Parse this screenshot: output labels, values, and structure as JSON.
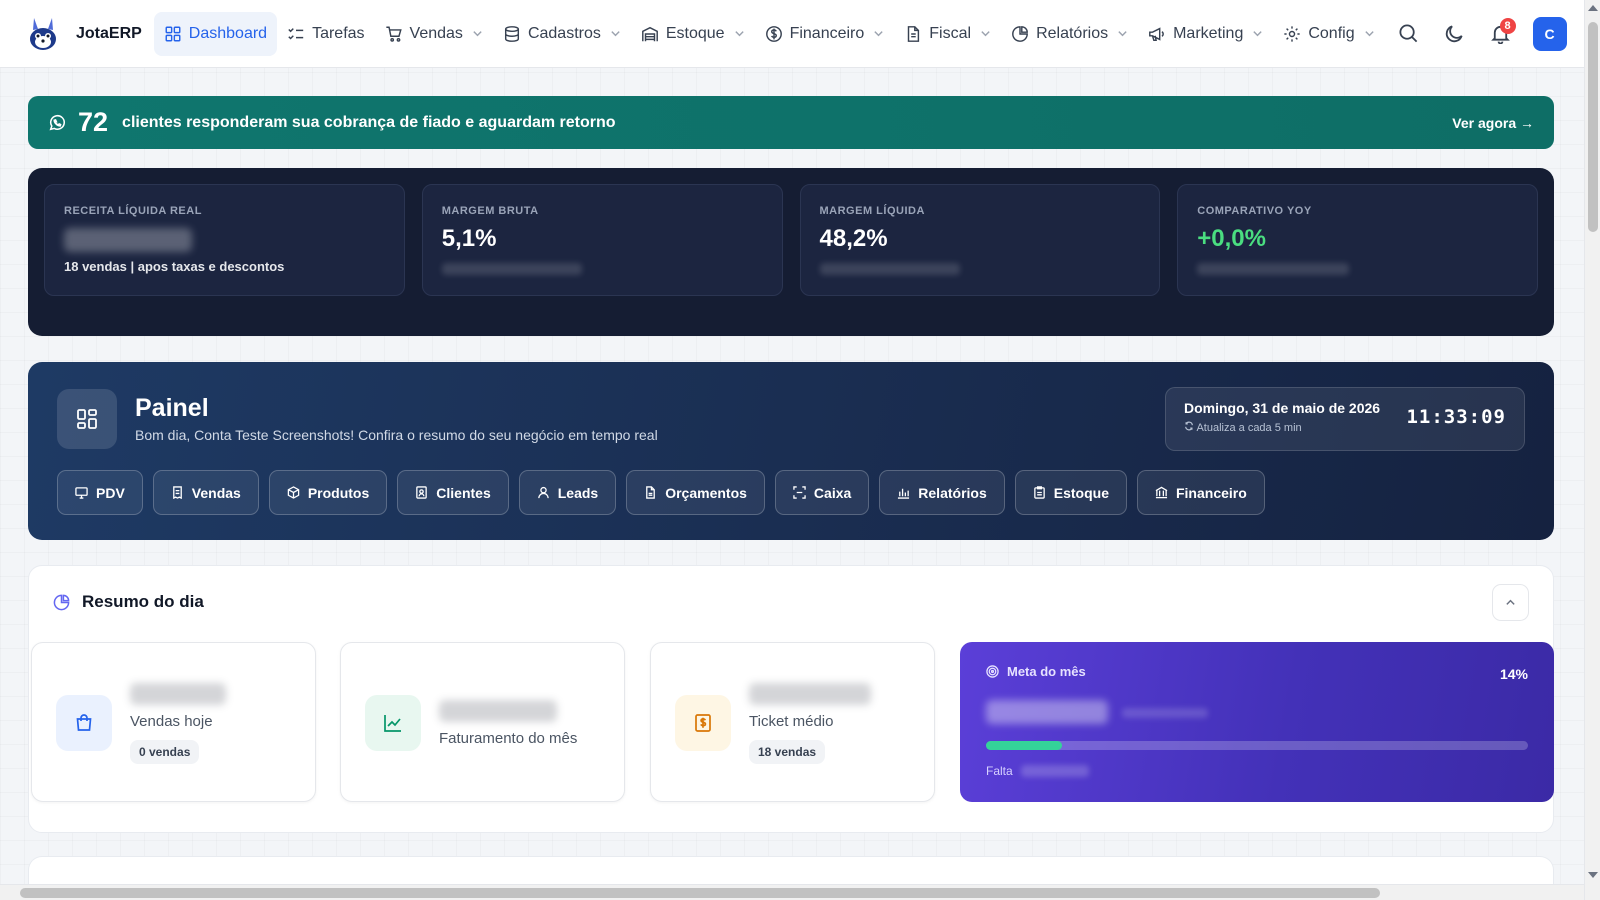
{
  "nav": {
    "brand": "JotaERP",
    "items": [
      {
        "label": "Dashboard",
        "icon": "grid-icon",
        "active": true,
        "dropdown": false
      },
      {
        "label": "Tarefas",
        "icon": "checklist-icon",
        "dropdown": false
      },
      {
        "label": "Vendas",
        "icon": "cart-icon",
        "dropdown": true
      },
      {
        "label": "Cadastros",
        "icon": "database-icon",
        "dropdown": true
      },
      {
        "label": "Estoque",
        "icon": "warehouse-icon",
        "dropdown": true
      },
      {
        "label": "Financeiro",
        "icon": "dollar-circle-icon",
        "dropdown": true
      },
      {
        "label": "Fiscal",
        "icon": "document-icon",
        "dropdown": true
      },
      {
        "label": "Relatórios",
        "icon": "pie-chart-icon",
        "dropdown": true
      },
      {
        "label": "Marketing",
        "icon": "megaphone-icon",
        "dropdown": true
      },
      {
        "label": "Config",
        "icon": "gear-icon",
        "dropdown": true
      }
    ],
    "notifications": "8",
    "avatar": "C"
  },
  "banner": {
    "count": "72",
    "message": "clientes responderam sua cobrança de fiado e aguardam retorno",
    "cta": "Ver agora →"
  },
  "kpis": [
    {
      "label": "RECEITA LÍQUIDA REAL",
      "value": null,
      "sub": "18 vendas | apos taxas e descontos"
    },
    {
      "label": "MARGEM BRUTA",
      "value": "5,1%",
      "sub": null
    },
    {
      "label": "MARGEM LÍQUIDA",
      "value": "48,2%",
      "sub": null
    },
    {
      "label": "COMPARATIVO YOY",
      "value": "+0,0%",
      "sub": null
    }
  ],
  "painel": {
    "title": "Painel",
    "subtitle": "Bom dia, Conta Teste Screenshots! Confira o resumo do seu negócio em tempo real",
    "date": "Domingo, 31 de maio de 2026",
    "refresh_hint": "Atualiza a cada 5 min",
    "clock": "11:33:09",
    "quick_links": [
      {
        "label": "PDV",
        "icon": "monitor-icon"
      },
      {
        "label": "Vendas",
        "icon": "receipt-icon"
      },
      {
        "label": "Produtos",
        "icon": "box-icon"
      },
      {
        "label": "Clientes",
        "icon": "contacts-icon"
      },
      {
        "label": "Leads",
        "icon": "user-icon"
      },
      {
        "label": "Orçamentos",
        "icon": "file-icon"
      },
      {
        "label": "Caixa",
        "icon": "scan-icon"
      },
      {
        "label": "Relatórios",
        "icon": "bar-chart-icon"
      },
      {
        "label": "Estoque",
        "icon": "clipboard-icon"
      },
      {
        "label": "Financeiro",
        "icon": "bank-icon"
      }
    ]
  },
  "resumo": {
    "title": "Resumo do dia",
    "cards": [
      {
        "label": "Vendas hoje",
        "pill": "0 vendas",
        "icon": "shopping-bag-icon",
        "color": "#2563eb"
      },
      {
        "label": "Faturamento do mês",
        "pill": null,
        "icon": "line-chart-icon",
        "color": "#059669"
      },
      {
        "label": "Ticket médio",
        "pill": "18 vendas",
        "icon": "dollar-doc-icon",
        "color": "#d97706"
      }
    ],
    "meta": {
      "title": "Meta do mês",
      "percent_label": "14%",
      "progress": 0.14,
      "falta_label": "Falta"
    }
  },
  "colors": {
    "accent": "#2563eb",
    "banner": "#0f766e",
    "kpi_bg": "#151d33",
    "positive": "#4ade80",
    "meta": "#4f38c8"
  }
}
